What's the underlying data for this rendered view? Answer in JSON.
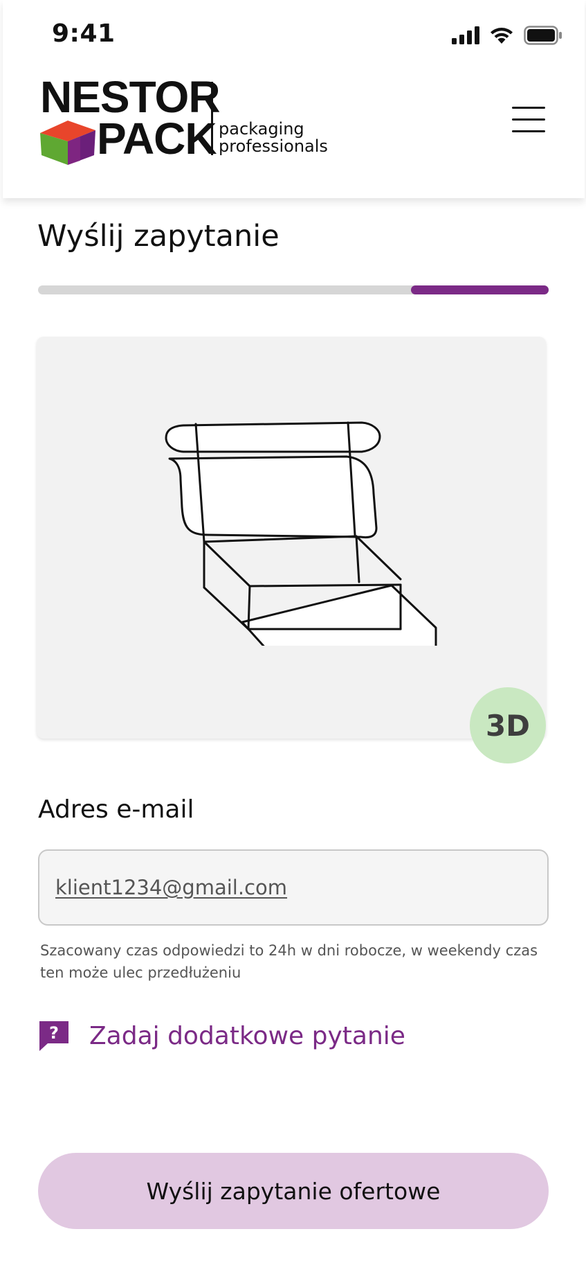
{
  "status_bar": {
    "time": "9:41",
    "icons": [
      "signal-icon",
      "wifi-icon",
      "battery-icon"
    ]
  },
  "header": {
    "logo": {
      "word1": "NESTOR",
      "word2": "PACK",
      "tagline_line1": "packaging",
      "tagline_line2": "professionals"
    },
    "menu_icon": "hamburger-menu-icon"
  },
  "page": {
    "title": "Wyślij zapytanie",
    "progress": {
      "fraction": 0.27,
      "fill_color": "#7b2a86",
      "track_color": "#d6d6d6"
    }
  },
  "preview": {
    "illustration": "mailer-box-outline",
    "badge_label": "3D",
    "badge_color": "#c9e8c1"
  },
  "form": {
    "email_label": "Adres e-mail",
    "email_value": "klient1234@gmail.com",
    "helper_text": "Szacowany czas odpowiedzi to 24h w dni robocze, w weekendy czas ten może ulec przedłużeniu"
  },
  "extra_question": {
    "icon": "question-speech-bubble-icon",
    "label": "Zadaj dodatkowe pytanie",
    "color": "#7b2a86"
  },
  "submit": {
    "label": "Wyślij zapytanie ofertowe",
    "background": "#e1c8e1"
  }
}
